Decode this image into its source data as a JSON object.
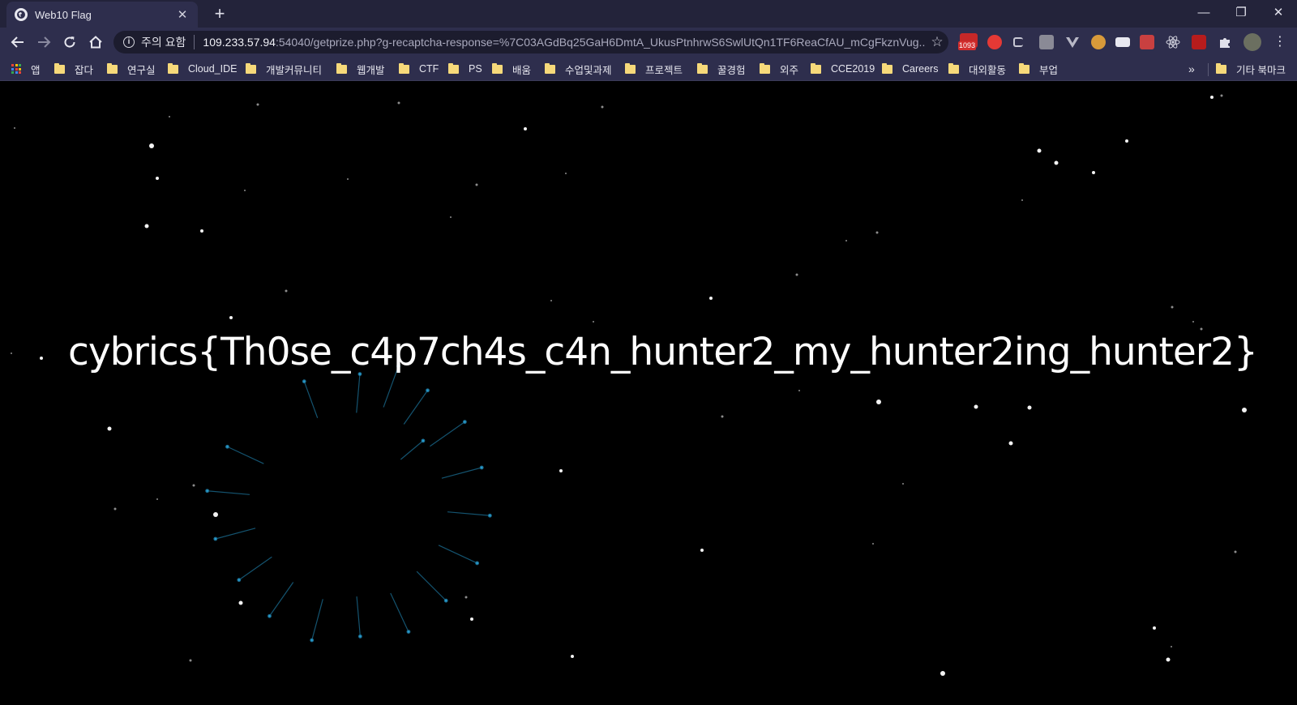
{
  "tab": {
    "title": "Web10 Flag"
  },
  "toolbar": {
    "security_label": "주의 요함",
    "url_host": "109.233.57.94",
    "url_rest": ":54040/getprize.php?g-recaptcha-response=%7C03AGdBq25GaH6DmtA_UkusPtnhrwS6SwlUtQn1TF6ReaCfAU_mCgFkznVug...",
    "gmail_badge": "1093"
  },
  "bookmarks": {
    "apps": "앱",
    "items": [
      "잡다",
      "연구실",
      "Cloud_IDE",
      "개발커뮤니티",
      "웹개발",
      "CTF",
      "PS",
      "배움",
      "수업및과제",
      "프로젝트",
      "꿀경험",
      "외주",
      "CCE2019",
      "Careers",
      "대외활동",
      "부업"
    ],
    "overflow": "»",
    "other": "기타 북마크"
  },
  "page": {
    "flag": "cybrics{Th0se_c4p7ch4s_c4n_hunter2_my_hunter2ing_hunter2}"
  },
  "colors": {
    "tab_strip": "#23233a",
    "toolbar": "#2e2e4d",
    "page_bg": "#000000",
    "accent_lines": "#1b7fa8"
  }
}
